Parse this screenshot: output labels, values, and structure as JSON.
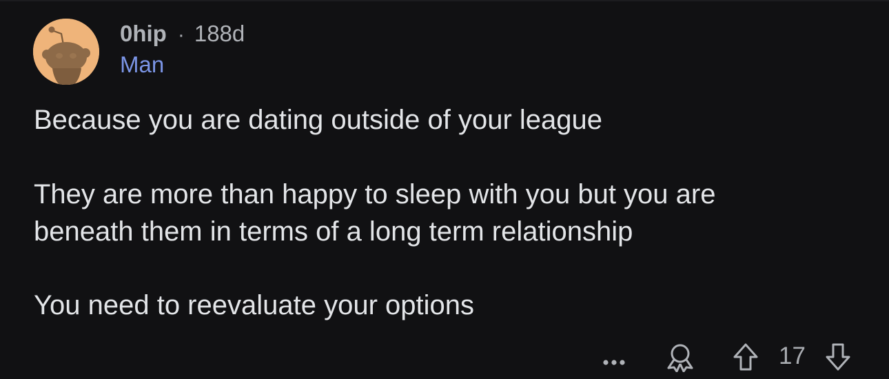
{
  "comment": {
    "username": "0hip",
    "separator": "·",
    "age": "188d",
    "flair": "Man",
    "paragraphs": {
      "p1": "Because you are dating outside of your league",
      "p2_line1": "They are more than happy to sleep with you but you are",
      "p2_line2": "beneath them in terms of a long term relationship",
      "p3": "You need to reevaluate your options"
    },
    "vote_count": "17"
  },
  "icons": {
    "avatar": "snoo-avatar",
    "more": "more-options-icon",
    "award": "award-icon",
    "upvote": "upvote-arrow-icon",
    "downvote": "downvote-arrow-icon"
  },
  "colors": {
    "background": "#111113",
    "avatar_bg": "#efb47a",
    "flair": "#7b95e6",
    "text_primary": "#e3e5e8",
    "text_meta": "#b0b3b8"
  }
}
